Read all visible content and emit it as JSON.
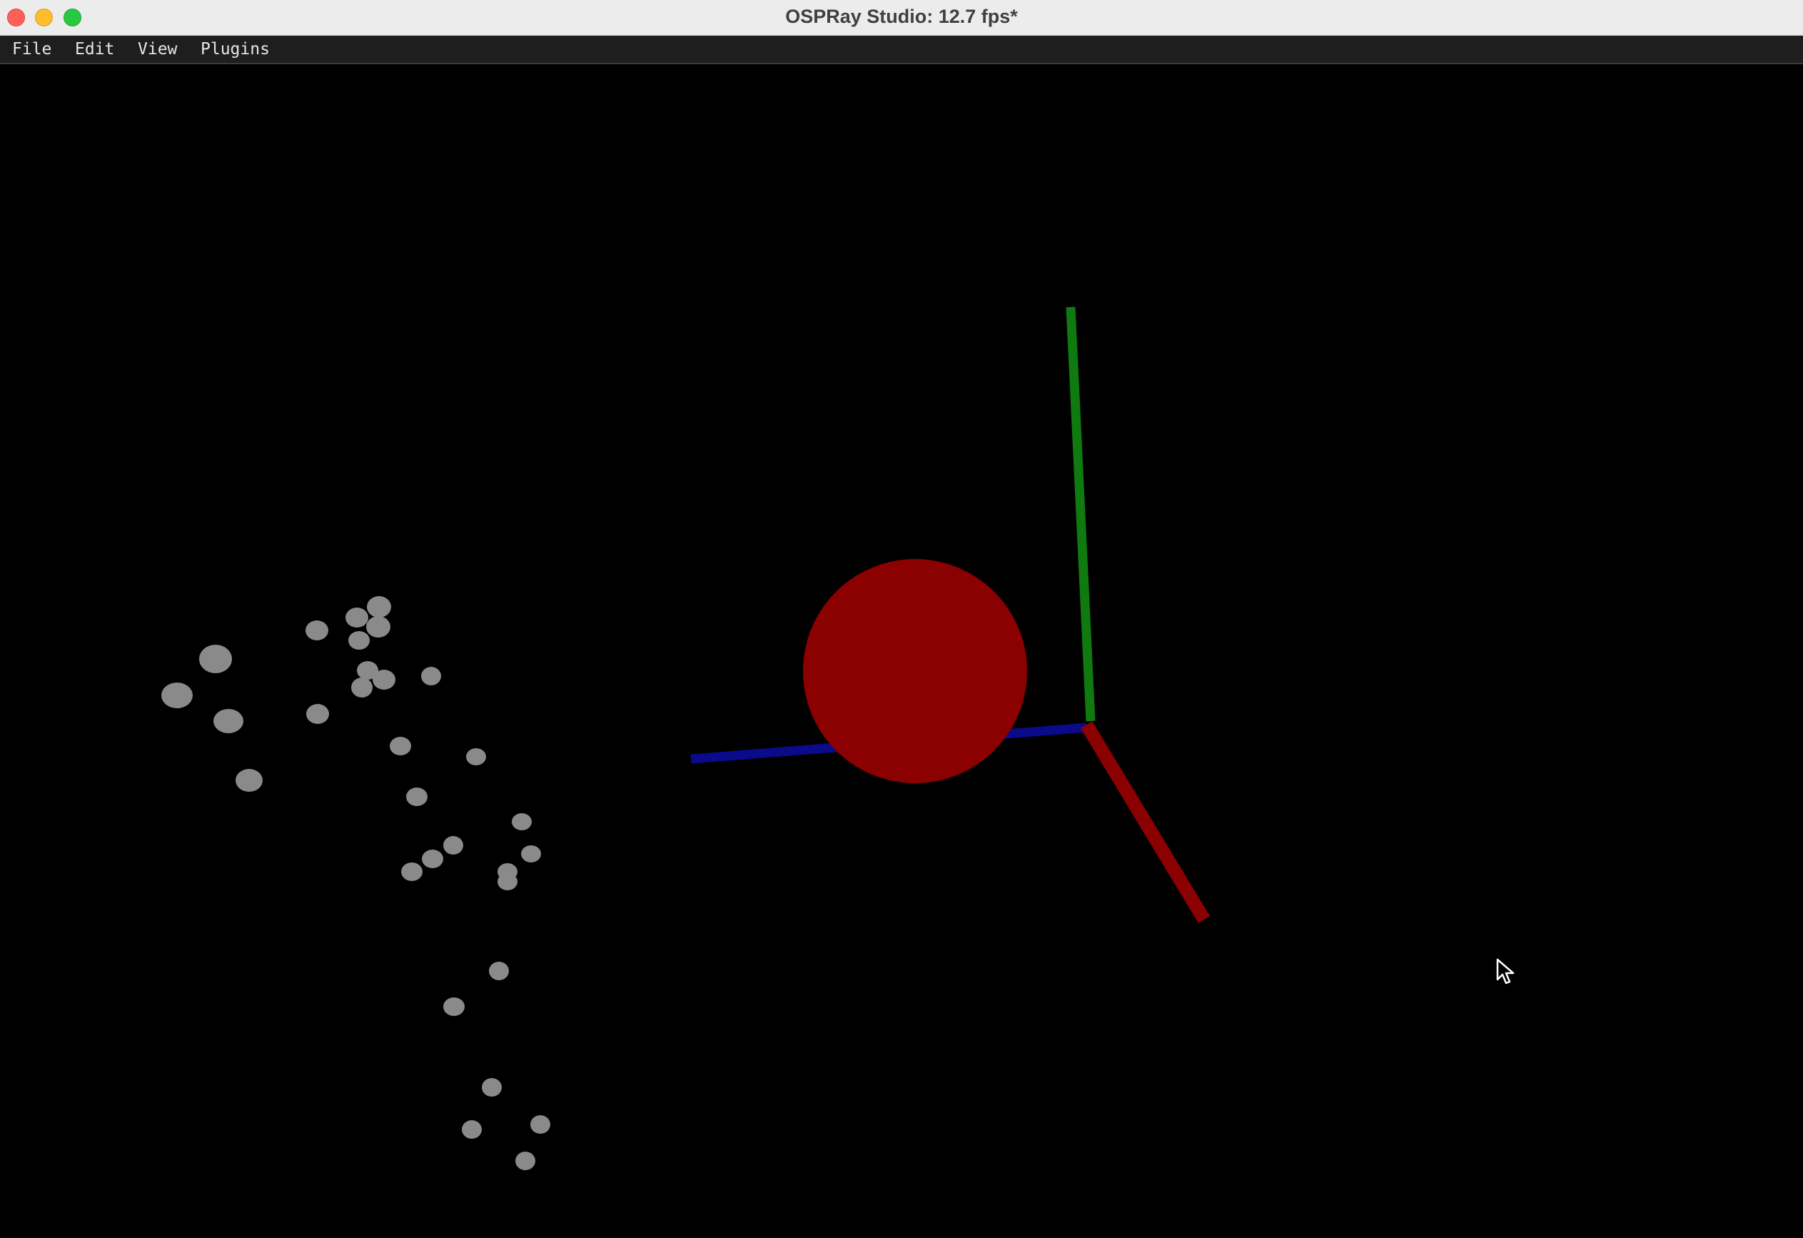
{
  "window": {
    "title": "OSPRay Studio: 12.7 fps*"
  },
  "menubar": {
    "items": [
      {
        "label": "File"
      },
      {
        "label": "Edit"
      },
      {
        "label": "View"
      },
      {
        "label": "Plugins"
      }
    ]
  },
  "scene": {
    "background_color": "#000000",
    "sphere_color": "#8b0000",
    "particle_color": "#8a8a8a",
    "axes": {
      "x_color": "#8b0000",
      "y_color": "#0f7a0f",
      "z_color": "#0a0a8a"
    }
  },
  "icons": {
    "traffic_lights": [
      "close-icon",
      "minimize-icon",
      "zoom-icon"
    ],
    "cursor": "mouse-pointer-icon"
  }
}
